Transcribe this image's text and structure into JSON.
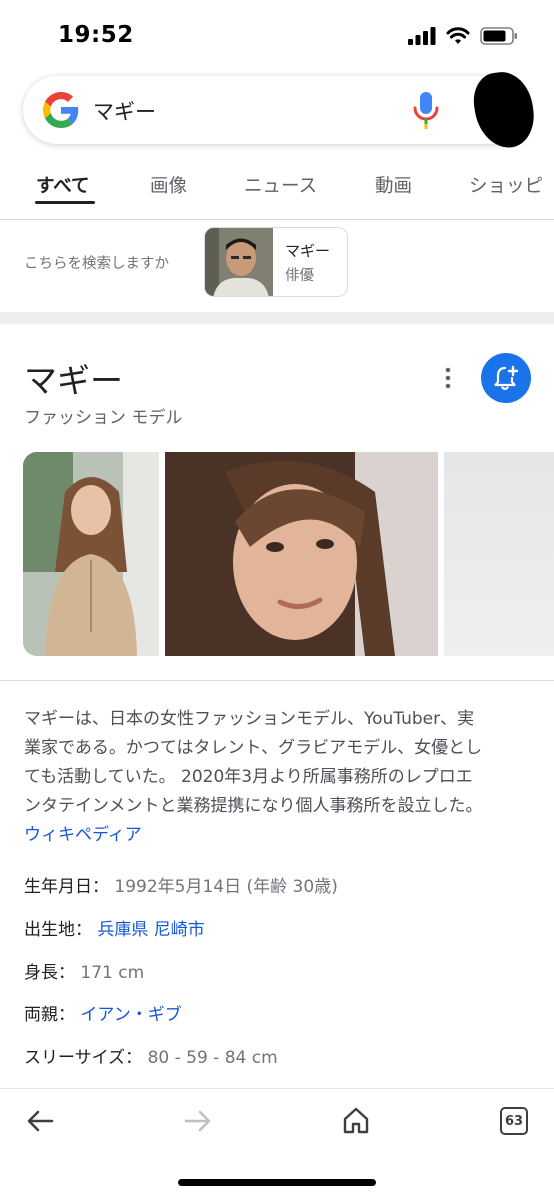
{
  "status": {
    "time": "19:52"
  },
  "search": {
    "query": "マギー"
  },
  "tabs": [
    {
      "label": "すべて",
      "active": true
    },
    {
      "label": "画像"
    },
    {
      "label": "ニュース"
    },
    {
      "label": "動画"
    },
    {
      "label": "ショッピ"
    }
  ],
  "suggestion": {
    "label": "こちらを検索しますか",
    "chip_title": "マギー",
    "chip_subtitle": "俳優"
  },
  "knowledge_panel": {
    "title": "マギー",
    "subtitle": "ファッション モデル",
    "description_lines": [
      "マギーは、日本の女性ファッションモデル、YouTuber、実",
      "業家である。かつてはタレント、グラビアモデル、女優とし",
      "ても活動していた。 2020年3月より所属事務所のレプロエ",
      "ンタテインメントと業務提携になり個人事務所を設立した。"
    ],
    "source_link": "ウィキペディア",
    "facts": [
      {
        "label": "生年月日：",
        "value": "1992年5月14日 (年齢 30歳)",
        "is_link": false
      },
      {
        "label": "出生地：",
        "value": "兵庫県 尼崎市",
        "is_link": true
      },
      {
        "label": "身長：",
        "value": "171 cm",
        "is_link": false
      },
      {
        "label": "両親：",
        "value": "イアン・ギブ",
        "is_link": true
      },
      {
        "label": "スリーサイズ：",
        "value": "80 - 59 - 84 cm",
        "is_link": false
      }
    ]
  },
  "bottom_bar": {
    "tab_count": "63"
  },
  "colors": {
    "accent": "#1a73e8",
    "link": "#1558d6"
  },
  "icons": [
    "google-logo-icon",
    "mic-icon",
    "more-vert-icon",
    "bell-plus-icon",
    "back-arrow-icon",
    "forward-arrow-icon",
    "home-icon",
    "tabs-icon"
  ]
}
